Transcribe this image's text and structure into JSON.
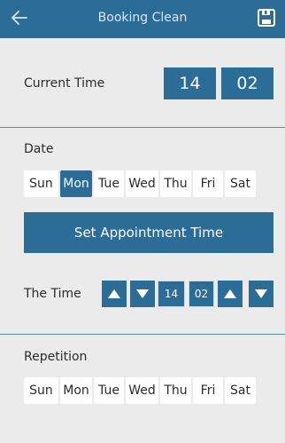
{
  "header": {
    "title": "Booking Clean",
    "back_icon": "back-arrow-icon",
    "save_icon": "save-icon"
  },
  "current_time": {
    "label": "Current Time",
    "hour": "14",
    "minute": "02"
  },
  "date": {
    "label": "Date",
    "days": [
      "Sun",
      "Mon",
      "Tue",
      "Wed",
      "Thu",
      "Fri",
      "Sat"
    ],
    "selected": "Mon"
  },
  "set_appointment": {
    "label": "Set Appointment Time"
  },
  "the_time": {
    "label": "The Time",
    "hour": "14",
    "minute": "02"
  },
  "repetition": {
    "label": "Repetition",
    "days": [
      "Sun",
      "Mon",
      "Tue",
      "Wed",
      "Thu",
      "Fri",
      "Sat"
    ]
  },
  "colors": {
    "accent": "#2b6d96",
    "background": "#ebebeb",
    "divider": "#5a89ad"
  }
}
